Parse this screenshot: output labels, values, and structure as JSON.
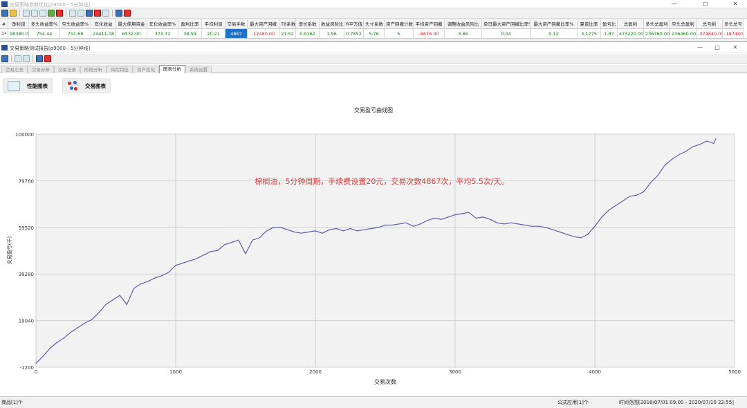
{
  "main_window": {
    "title": "交易策略参数优化[p9000 - 5分钟线]"
  },
  "summary_grid": {
    "headers": [
      "#",
      "净利润",
      "多头收益率%",
      "空头收益率%",
      "年化收益",
      "最大使用资金",
      "年化收益率%",
      "盈利比率",
      "平均利润",
      "交易手数",
      "最大资产回撤",
      "TB系数",
      "增长系数",
      "收益风险比",
      "R平方值",
      "头寸系数",
      "资产回撤计数",
      "平均资产回撤",
      "调整收益风险比",
      "单日最大资产回撤比率%",
      "最大资产回撤比率%",
      "夏普比率",
      "盈亏比",
      "总盈利",
      "多头总盈利",
      "空头总盈利",
      "总亏损",
      "多头总亏"
    ],
    "row": [
      "1*",
      "98380.00",
      "754.44",
      "751.68",
      "24411.08",
      "6532.00",
      "373.72",
      "38.59",
      "20.21",
      "4867",
      "-12480.00",
      "21.52",
      "0.0162",
      "1.96",
      "0.7852",
      "5.76",
      "5",
      "-6676.00",
      "3.66",
      "0.04",
      "0.12",
      "3.1275",
      "1.87",
      "473220.00",
      "236760.00",
      "236460.00",
      "-374840.00",
      "-187480."
    ]
  },
  "report_window": {
    "title": "交易策略测试报告[p9000 - 5分钟线]"
  },
  "tabs": [
    "交易汇总",
    "交易分析",
    "交易记录",
    "阶段分析",
    "风险特征",
    "资产变化",
    "图表分析",
    "系统设置"
  ],
  "active_tab": "图表分析",
  "buttons": {
    "perf_chart": "性能图表",
    "trade_chart": "交易图表"
  },
  "chart_data": {
    "type": "line",
    "title": "交易盈亏曲线图",
    "xlabel": "交易次数",
    "ylabel": "交易盈亏(千)",
    "x_ticks": [
      0,
      1000,
      2000,
      3000,
      4000,
      5000
    ],
    "y_ticks": [
      -1200,
      19040,
      39280,
      59520,
      79760,
      100000
    ],
    "xlim": [
      0,
      5000
    ],
    "ylim": [
      -1200,
      100000
    ],
    "grid": true,
    "line_color": "#5c5cb0",
    "annotation": "棕榈油，5分钟周期，手续费设置20元，交易次数4867次，平均5.5次/天。",
    "annotation_color": "#e03a3a",
    "series": [
      {
        "x": [
          0,
          50,
          100,
          150,
          200,
          250,
          300,
          350,
          400,
          450,
          500,
          550,
          600,
          650,
          700,
          750,
          800,
          850,
          900,
          950,
          1000,
          1050,
          1100,
          1150,
          1200,
          1250,
          1300,
          1350,
          1400,
          1450,
          1500,
          1550,
          1600,
          1650,
          1700,
          1750,
          1800,
          1850,
          1900,
          1950,
          2000,
          2050,
          2100,
          2150,
          2200,
          2250,
          2300,
          2350,
          2400,
          2450,
          2500,
          2550,
          2600,
          2650,
          2700,
          2750,
          2800,
          2850,
          2900,
          2950,
          3000,
          3050,
          3100,
          3150,
          3200,
          3250,
          3300,
          3350,
          3400,
          3450,
          3500,
          3550,
          3600,
          3650,
          3700,
          3750,
          3800,
          3850,
          3900,
          3950,
          4000,
          4050,
          4100,
          4150,
          4200,
          4250,
          4300,
          4350,
          4400,
          4450,
          4500,
          4550,
          4600,
          4650,
          4700,
          4750,
          4800,
          4850,
          4867
        ],
        "values": [
          500,
          3500,
          7000,
          9500,
          11500,
          14000,
          16000,
          18000,
          19500,
          22500,
          26000,
          28000,
          30000,
          26000,
          33000,
          35000,
          36000,
          37500,
          38500,
          40000,
          43000,
          44000,
          45000,
          46000,
          47500,
          49000,
          49500,
          52000,
          53000,
          54000,
          48000,
          54000,
          55000,
          58000,
          59500,
          59500,
          58500,
          57500,
          57000,
          57500,
          58000,
          57000,
          58500,
          59000,
          58000,
          59000,
          58000,
          58500,
          59000,
          59500,
          60500,
          60500,
          61000,
          61500,
          60000,
          61000,
          62500,
          63500,
          63000,
          64000,
          65000,
          65500,
          66000,
          63500,
          64000,
          63000,
          61500,
          61000,
          61500,
          61000,
          60500,
          60000,
          60000,
          59500,
          58500,
          57500,
          56500,
          55500,
          55000,
          56500,
          60000,
          64000,
          67000,
          69000,
          71000,
          73000,
          73500,
          75000,
          79000,
          82000,
          86500,
          89000,
          91000,
          92500,
          94500,
          95500,
          97000,
          96000,
          98000
        ]
      }
    ]
  },
  "status": {
    "left": "商品[1]个",
    "middle": "公式应用[1]个",
    "right": "时间范围[2016/07/01 09:00 - 2020/07/10 22:55]"
  }
}
